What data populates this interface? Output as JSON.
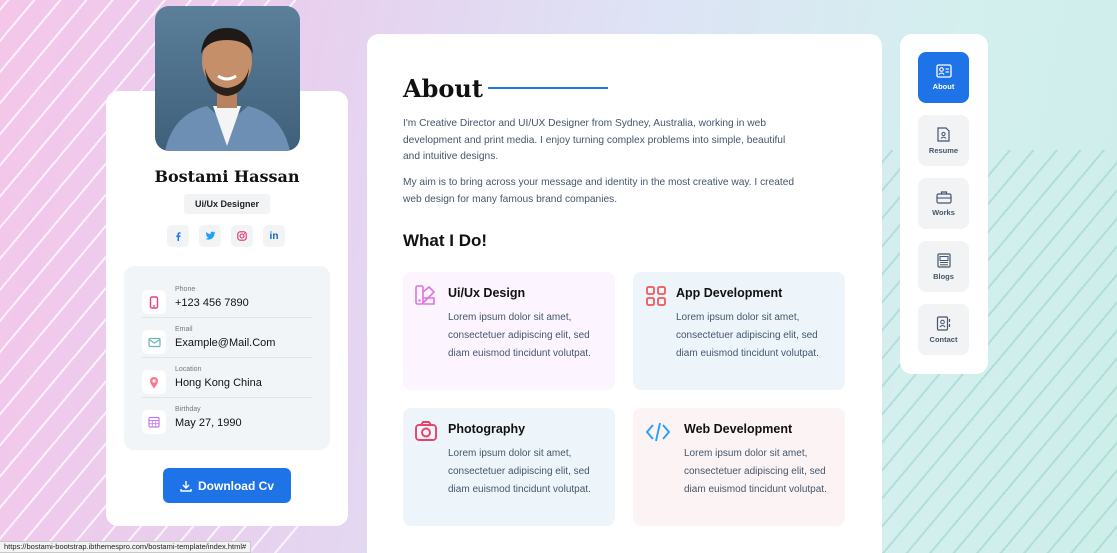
{
  "profile": {
    "name": "Bostami Hassan",
    "role": "Ui/Ux Designer",
    "socials": [
      {
        "icon": "facebook-icon",
        "glyph": "f",
        "color": "#1877f2"
      },
      {
        "icon": "twitter-icon",
        "glyph": "t",
        "color": "#1da1f2"
      },
      {
        "icon": "instagram-icon",
        "glyph": "◎",
        "color": "#e1306c"
      },
      {
        "icon": "linkedin-icon",
        "glyph": "in",
        "color": "#0a66c2"
      }
    ],
    "contacts": [
      {
        "label": "Phone",
        "value": "+123 456 7890",
        "icon": "phone-icon",
        "color": "#e93b81"
      },
      {
        "label": "Email",
        "value": "Example@Mail.Com",
        "icon": "email-icon",
        "color": "#6ab5b9"
      },
      {
        "label": "Location",
        "value": "Hong Kong China",
        "icon": "location-icon",
        "color": "#fd7590"
      },
      {
        "label": "Birthday",
        "value": "May 27, 1990",
        "icon": "calendar-icon",
        "color": "#c17ceb"
      }
    ],
    "download_label": "Download Cv"
  },
  "about": {
    "title": "About",
    "paragraph1": "I'm Creative Director and UI/UX Designer from Sydney, Australia, working in web development and print media. I enjoy turning complex problems into simple, beautiful and intuitive designs.",
    "paragraph2": "My aim is to bring across your message and identity in the most creative way. I created web design for many famous brand companies."
  },
  "what_i_do": {
    "title": "What I Do!",
    "services": [
      {
        "title": "Ui/Ux Design",
        "desc": "Lorem ipsum dolor sit amet, consectetuer adipiscing elit, sed diam euismod tincidunt volutpat.",
        "icon": "design-icon",
        "color": "#dd75e0",
        "bg": "#fcf4ff"
      },
      {
        "title": "App Development",
        "desc": "Lorem ipsum dolor sit amet, consectetuer adipiscing elit, sed diam euismod tincidunt volutpat.",
        "icon": "grid-icon",
        "color": "#ec5b5b",
        "bg": "#eef5fa"
      },
      {
        "title": "Photography",
        "desc": "Lorem ipsum dolor sit amet, consectetuer adipiscing elit, sed diam euismod tincidunt volutpat.",
        "icon": "camera-icon",
        "color": "#e9426b",
        "bg": "#eef5fa"
      },
      {
        "title": "Web Development",
        "desc": "Lorem ipsum dolor sit amet, consectetuer adipiscing elit, sed diam euismod tincidunt volutpat.",
        "icon": "code-icon",
        "color": "#269fff",
        "bg": "#fcf4f4"
      }
    ]
  },
  "nav": {
    "items": [
      {
        "label": "About",
        "icon": "about-icon",
        "active": true
      },
      {
        "label": "Resume",
        "icon": "resume-icon",
        "active": false
      },
      {
        "label": "Works",
        "icon": "briefcase-icon",
        "active": false
      },
      {
        "label": "Blogs",
        "icon": "blog-icon",
        "active": false
      },
      {
        "label": "Contact",
        "icon": "contact-icon",
        "active": false
      }
    ]
  },
  "status_url": "https://bostami-bootstrap.ibthemespro.com/bostami-template/index.html#",
  "colors": {
    "accent": "#1e74e6"
  }
}
